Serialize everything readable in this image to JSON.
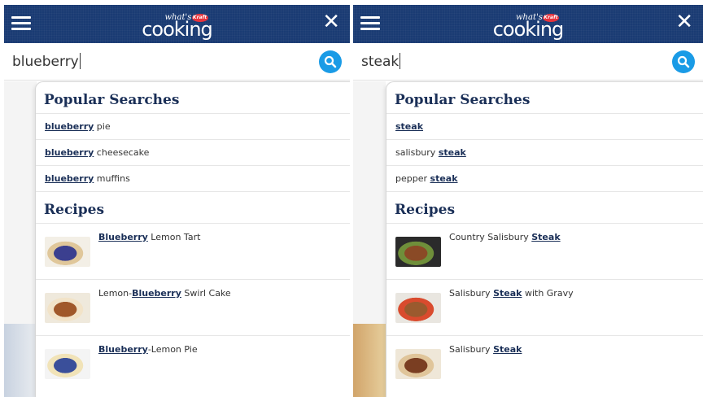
{
  "panels": [
    {
      "query": "blueberry",
      "popular_title": "Popular Searches",
      "suggestions": [
        {
          "before": "",
          "hl": "blueberry",
          "after": " pie"
        },
        {
          "before": "",
          "hl": "blueberry",
          "after": " cheesecake"
        },
        {
          "before": "",
          "hl": "blueberry",
          "after": " muffins"
        }
      ],
      "recipes_title": "Recipes",
      "recipes": [
        {
          "before": "",
          "hl": "Blueberry",
          "after": " Lemon Tart",
          "thumb": [
            "#f3efe6",
            "#3b3f8f",
            "#e0c79a"
          ]
        },
        {
          "before": "Lemon-",
          "hl": "Blueberry",
          "after": " Swirl Cake",
          "thumb": [
            "#efe9dc",
            "#a0582a",
            "#f2e3c8"
          ]
        },
        {
          "before": "",
          "hl": "Blueberry",
          "after": "-Lemon Pie",
          "thumb": [
            "#f4f4f4",
            "#3a4f9a",
            "#f1e3b8"
          ]
        }
      ]
    },
    {
      "query": "steak",
      "popular_title": "Popular Searches",
      "suggestions": [
        {
          "before": "",
          "hl": "steak",
          "after": ""
        },
        {
          "before": "salisbury ",
          "hl": "steak",
          "after": ""
        },
        {
          "before": "pepper ",
          "hl": "steak",
          "after": ""
        }
      ],
      "recipes_title": "Recipes",
      "recipes": [
        {
          "before": "Country Salisbury ",
          "hl": "Steak",
          "after": "",
          "thumb": [
            "#2b2b2b",
            "#8a4a26",
            "#6f8f3a"
          ]
        },
        {
          "before": "Salisbury ",
          "hl": "Steak",
          "after": " with Gravy",
          "thumb": [
            "#e9e6e0",
            "#9a5a2e",
            "#d94b2e"
          ]
        },
        {
          "before": "Salisbury ",
          "hl": "Steak",
          "after": "",
          "thumb": [
            "#efe7d8",
            "#7a3e22",
            "#e0c59a"
          ]
        }
      ]
    }
  ],
  "colors": {
    "header": "#1a3b73",
    "accent": "#1a9be6",
    "title": "#1a2f57"
  },
  "icons": {
    "menu": "hamburger-icon",
    "close": "close-icon",
    "search": "search-icon",
    "logo": "whats-cooking-logo"
  },
  "logo_text": {
    "whats": "what's",
    "brand": "Kraft",
    "cooking": "cooking"
  }
}
